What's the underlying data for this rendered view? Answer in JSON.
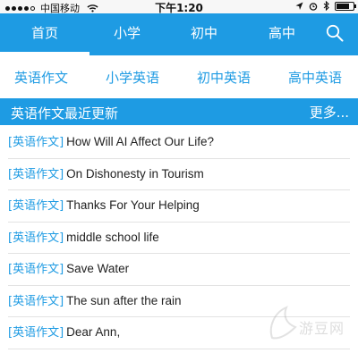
{
  "status_bar": {
    "carrier": "中国移动",
    "time": "下午1:20",
    "battery_level": 0.75,
    "icons": [
      "signal-icon",
      "wifi-icon",
      "location-arrow-icon",
      "alarm-icon",
      "bluetooth-icon",
      "battery-icon"
    ]
  },
  "nav": {
    "tabs": [
      {
        "label": "首页",
        "active": true
      },
      {
        "label": "小学",
        "active": false
      },
      {
        "label": "初中",
        "active": false
      },
      {
        "label": "高中",
        "active": false
      }
    ],
    "search_icon": "search-icon"
  },
  "sub_tabs": [
    "英语作文",
    "小学英语",
    "初中英语",
    "高中英语"
  ],
  "section": {
    "title": "英语作文最近更新",
    "more": "更多..."
  },
  "articles": [
    {
      "tag": "[英语作文]",
      "title": "How Will AI Affect Our Life?"
    },
    {
      "tag": "[英语作文]",
      "title": "On Dishonesty in Tourism"
    },
    {
      "tag": "[英语作文]",
      "title": "Thanks For Your Helping"
    },
    {
      "tag": "[英语作文]",
      "title": "middle school life"
    },
    {
      "tag": "[英语作文]",
      "title": "Save Water"
    },
    {
      "tag": "[英语作文]",
      "title": "The sun after the rain"
    },
    {
      "tag": "[英语作文]",
      "title": "Dear Ann,"
    }
  ],
  "colors": {
    "accent": "#1e9be3",
    "text": "#222222",
    "divider": "#e2e2e2"
  }
}
